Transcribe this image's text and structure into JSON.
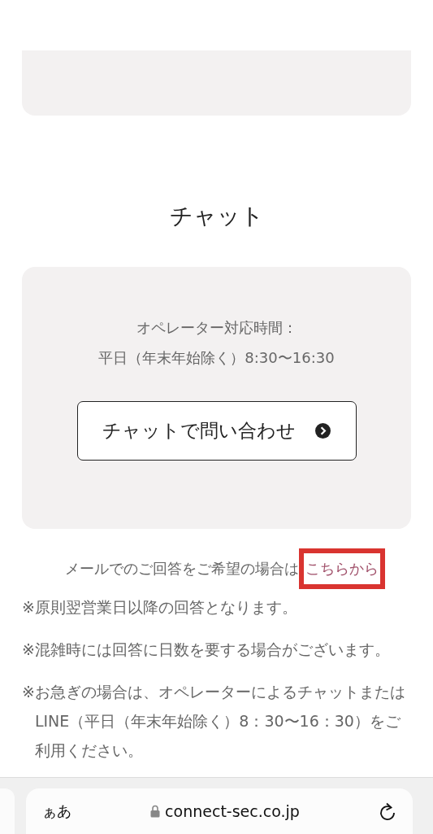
{
  "section_title": "チャット",
  "hours": {
    "label": "オペレーター対応時間：",
    "value": "平日（年末年始除く）8:30〜16:30"
  },
  "chat_button": {
    "label": "チャットで問い合わせ"
  },
  "mail": {
    "text": "メールでのご回答をご希望の場合は",
    "link": "こちらから",
    "highlighted": true
  },
  "notes": [
    {
      "mark": "※",
      "text": "原則翌営業日以降の回答となります。"
    },
    {
      "mark": "※",
      "text": "混雑時には回答に日数を要する場合がございます。"
    },
    {
      "mark": "※",
      "text": "お急ぎの場合は、オペレーターによるチャットまたはLINE（平日（年末年始除く）8：30〜16：30）をご利用ください。"
    }
  ],
  "browser_bar": {
    "text_size_button": "ぁあ",
    "url": "connect-sec.co.jp"
  }
}
